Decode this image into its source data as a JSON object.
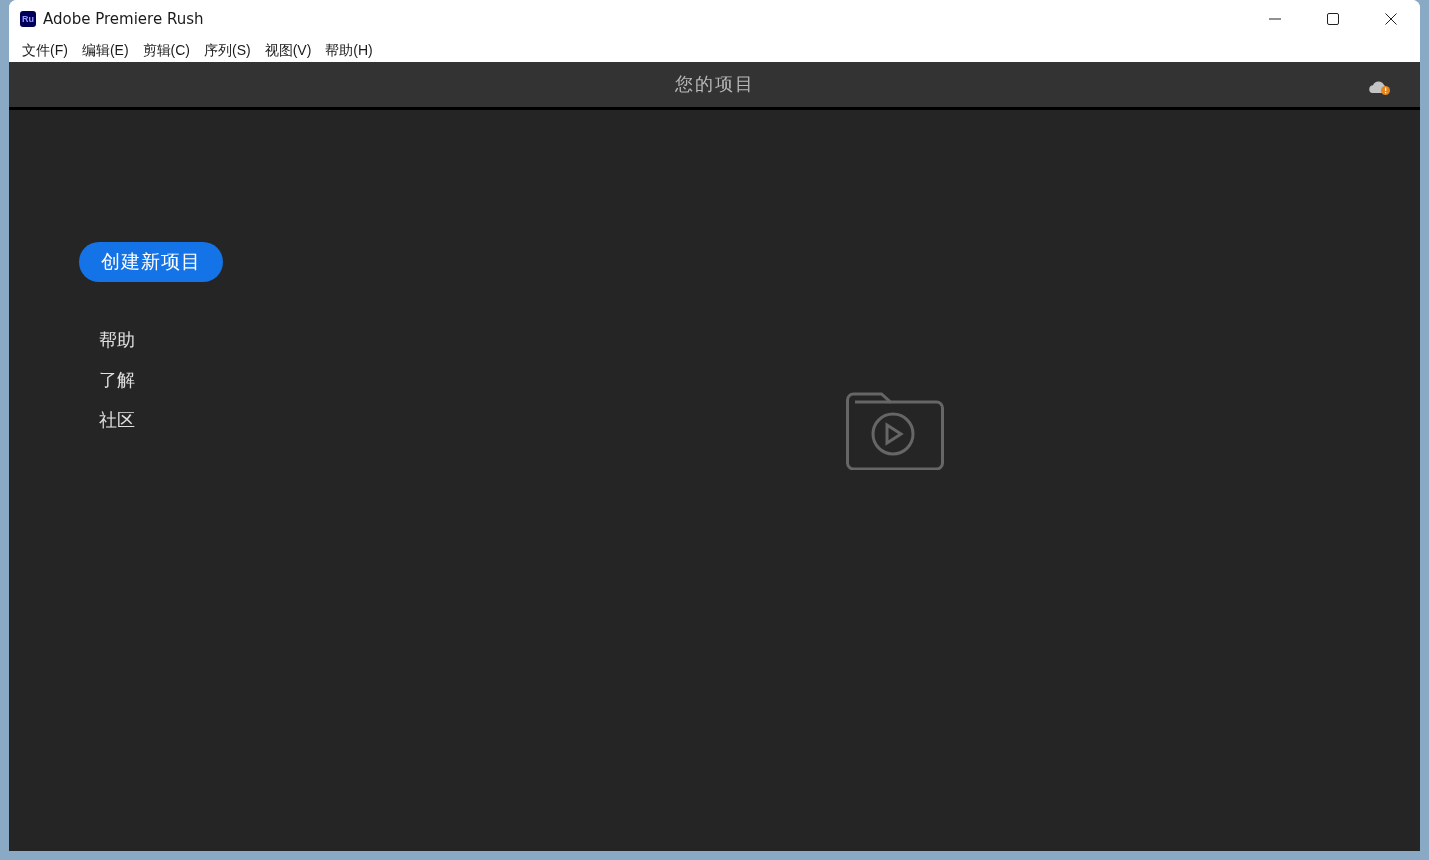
{
  "window": {
    "title": "Adobe Premiere Rush",
    "app_icon_text": "Ru"
  },
  "menu_bar": [
    "文件(F)",
    "编辑(E)",
    "剪辑(C)",
    "序列(S)",
    "视图(V)",
    "帮助(H)"
  ],
  "header": {
    "title": "您的项目"
  },
  "sidebar": {
    "create_button": "创建新项目",
    "links": [
      "帮助",
      "了解",
      "社区"
    ]
  }
}
